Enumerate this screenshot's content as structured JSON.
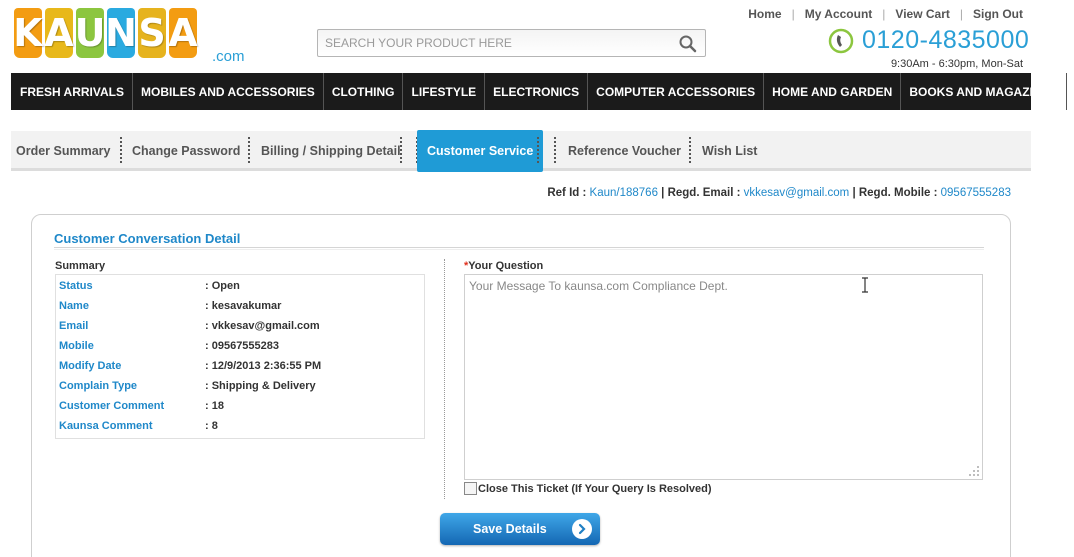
{
  "logo": {
    "letters": [
      "K",
      "A",
      "U",
      "N",
      "S",
      "A"
    ],
    "letter_colors": [
      "#f39c12",
      "#e8b81a",
      "#8cc63f",
      "#2aaae0",
      "#e6b31e",
      "#f39c12"
    ],
    "dotcom": ".com"
  },
  "search": {
    "placeholder": "SEARCH YOUR PRODUCT HERE"
  },
  "top_links": [
    "Home",
    "My Account",
    "View Cart",
    "Sign Out"
  ],
  "phone": {
    "number": "0120-4835000",
    "hours": "9:30Am - 6:30pm, Mon-Sat"
  },
  "nav": [
    "FRESH ARRIVALS",
    "MOBILES AND ACCESSORIES",
    "CLOTHING",
    "LIFESTYLE",
    "ELECTRONICS",
    "COMPUTER ACCESSORIES",
    "HOME AND GARDEN",
    "BOOKS AND MAGAZINES"
  ],
  "tabs": [
    "Order Summary",
    "Change Password",
    "Billing / Shipping Detail",
    "Customer Service",
    "Reference Voucher",
    "Wish List"
  ],
  "active_tab": "Customer Service",
  "ref": {
    "ref_label": "Ref Id : ",
    "ref_value": "Kaun/188766",
    "email_label": " | Regd. Email : ",
    "email_value": "vkkesav@gmail.com",
    "mobile_label": " | Regd. Mobile : ",
    "mobile_value": "09567555283"
  },
  "panel": {
    "title": "Customer Conversation Detail",
    "summary_label": "Summary",
    "summary": [
      {
        "key": "Status",
        "value": ": Open"
      },
      {
        "key": "Name",
        "value": ": kesavakumar"
      },
      {
        "key": "Email",
        "value": ": vkkesav@gmail.com"
      },
      {
        "key": "Mobile",
        "value": ": 09567555283"
      },
      {
        "key": "Modify Date",
        "value": ": 12/9/2013 2:36:55 PM"
      },
      {
        "key": "Complain Type",
        "value": ": Shipping & Delivery"
      },
      {
        "key": "Customer Comment",
        "value": ": 18"
      },
      {
        "key": "Kaunsa Comment",
        "value": ": 8"
      }
    ],
    "question_required_mark": "*",
    "question_label": "Your Question",
    "question_placeholder": "Your Message To kaunsa.com Compliance Dept.",
    "close_ticket_label": "Close This Ticket (If Your Query Is Resolved)",
    "save_label": "Save Details"
  },
  "colors": {
    "accent": "#1f9bd6",
    "nav_bg": "#1b1b1b",
    "link": "#1f88c9"
  }
}
